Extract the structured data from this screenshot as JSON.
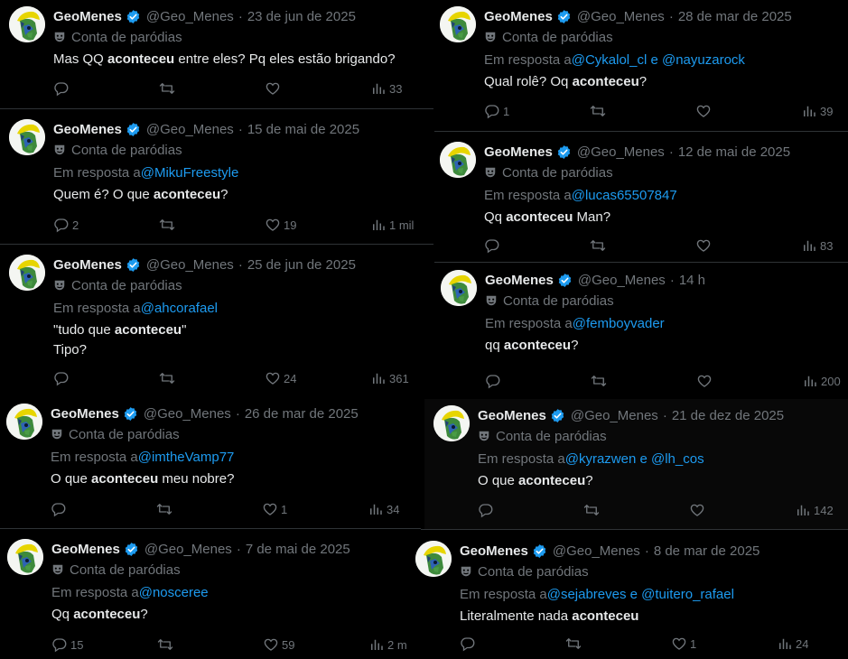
{
  "colors": {
    "background": "#000000",
    "text": "#e7e9ea",
    "muted": "#71767b",
    "link": "#1d9bf0",
    "verified": "#1d9bf0",
    "divider": "#2f3336"
  },
  "icons": [
    "avatar",
    "verified-badge-icon",
    "parody-mask-icon",
    "reply-icon",
    "retweet-icon",
    "like-icon",
    "views-icon"
  ],
  "tweets": [
    {
      "name": "GeoMenes",
      "handle": "@Geo_Menes",
      "date": "23 de jun de 2025",
      "parody": "Conta de paródias",
      "reply_prefix": "",
      "reply_to": "",
      "text1": "Mas QQ ",
      "text_bold": "aconteceu",
      "text2": " entre eles? Pq eles estão brigando?",
      "line2": "",
      "replies": "",
      "likes": "",
      "views": "33"
    },
    {
      "name": "GeoMenes",
      "handle": "@Geo_Menes",
      "date": "15 de mai de 2025",
      "parody": "Conta de paródias",
      "reply_prefix": "Em resposta a ",
      "reply_to": "@MikuFreestyle",
      "text1": "Quem é? O que ",
      "text_bold": "aconteceu",
      "text2": "?",
      "line2": "",
      "replies": "2",
      "likes": "19",
      "views": "1 mil"
    },
    {
      "name": "GeoMenes",
      "handle": "@Geo_Menes",
      "date": "25 de jun de 2025",
      "parody": "Conta de paródias",
      "reply_prefix": "Em resposta a ",
      "reply_to": "@ahcorafael",
      "text1": "\"tudo que ",
      "text_bold": "aconteceu",
      "text2": "\"",
      "line2": "Tipo?",
      "replies": "",
      "likes": "24",
      "views": "361"
    },
    {
      "name": "GeoMenes",
      "handle": "@Geo_Menes",
      "date": "26 de mar de 2025",
      "parody": "Conta de paródias",
      "reply_prefix": "Em resposta a ",
      "reply_to": "@imtheVamp77",
      "text1": "O que ",
      "text_bold": "aconteceu",
      "text2": " meu nobre?",
      "line2": "",
      "replies": "",
      "likes": "1",
      "views": "34"
    },
    {
      "name": "GeoMenes",
      "handle": "@Geo_Menes",
      "date": "7 de mai de 2025",
      "parody": "Conta de paródias",
      "reply_prefix": "Em resposta a ",
      "reply_to": "@nosceree",
      "text1": "Qq ",
      "text_bold": "aconteceu",
      "text2": "?",
      "line2": "",
      "replies": "15",
      "likes": "59",
      "views": "2 m"
    },
    {
      "name": "GeoMenes",
      "handle": "@Geo_Menes",
      "date": "28 de mar de 2025",
      "parody": "Conta de paródias",
      "reply_prefix": "Em resposta a ",
      "reply_to": "@Cykalol_cl e @nayuzarock",
      "text1": "Qual rolê? Oq ",
      "text_bold": "aconteceu",
      "text2": "?",
      "line2": "",
      "replies": "1",
      "likes": "",
      "views": "39"
    },
    {
      "name": "GeoMenes",
      "handle": "@Geo_Menes",
      "date": "12 de mai de 2025",
      "parody": "Conta de paródias",
      "reply_prefix": "Em resposta a ",
      "reply_to": "@lucas65507847",
      "text1": "Qq ",
      "text_bold": "aconteceu",
      "text2": " Man?",
      "line2": "",
      "replies": "",
      "likes": "",
      "views": "83"
    },
    {
      "name": "GeoMenes",
      "handle": "@Geo_Menes",
      "date": "14 h",
      "parody": "Conta de paródias",
      "reply_prefix": "Em resposta a ",
      "reply_to": "@femboyvader",
      "text1": "qq ",
      "text_bold": "aconteceu",
      "text2": "?",
      "line2": "",
      "replies": "",
      "likes": "",
      "views": "200"
    },
    {
      "name": "GeoMenes",
      "handle": "@Geo_Menes",
      "date": "21 de dez de 2025",
      "parody": "Conta de paródias",
      "reply_prefix": "Em resposta a ",
      "reply_to": "@kyrazwen e @lh_cos",
      "text1": "O que ",
      "text_bold": "aconteceu",
      "text2": "?",
      "line2": "",
      "replies": "",
      "likes": "",
      "views": "142"
    },
    {
      "name": "GeoMenes",
      "handle": "@Geo_Menes",
      "date": "8 de mar de 2025",
      "parody": "Conta de paródias",
      "reply_prefix": "Em resposta a ",
      "reply_to": "@sejabreves e @tuitero_rafael",
      "text1": "Literalmente nada ",
      "text_bold": "aconteceu",
      "text2": "",
      "line2": "",
      "replies": "",
      "likes": "1",
      "views": "24"
    }
  ]
}
